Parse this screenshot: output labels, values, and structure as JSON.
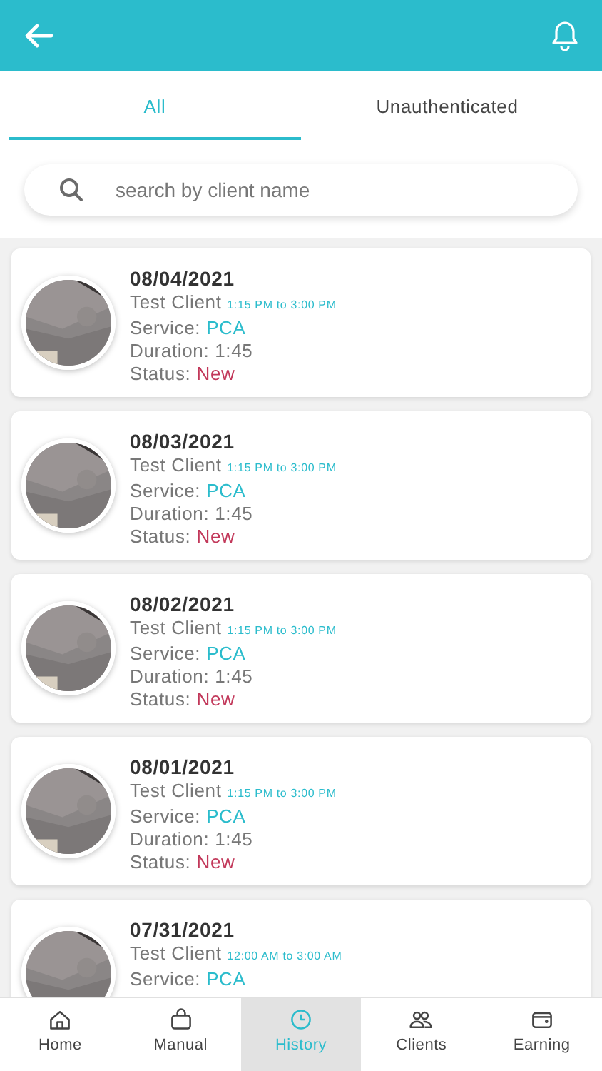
{
  "tabs": [
    {
      "label": "All",
      "selected": true
    },
    {
      "label": "Unauthenticated",
      "selected": false
    }
  ],
  "search": {
    "placeholder": "search by client name"
  },
  "visits": [
    {
      "date": "08/04/2021",
      "client": "Test Client",
      "time": "1:15 PM to 3:00 PM",
      "service_label": "Service:",
      "service": "PCA",
      "duration": "Duration: 1:45",
      "status_label": "Status:",
      "status": "New"
    },
    {
      "date": "08/03/2021",
      "client": "Test Client",
      "time": "1:15 PM to 3:00 PM",
      "service_label": "Service:",
      "service": "PCA",
      "duration": "Duration: 1:45",
      "status_label": "Status:",
      "status": "New"
    },
    {
      "date": "08/02/2021",
      "client": "Test Client",
      "time": "1:15 PM to 3:00 PM",
      "service_label": "Service:",
      "service": "PCA",
      "duration": "Duration: 1:45",
      "status_label": "Status:",
      "status": "New"
    },
    {
      "date": "08/01/2021",
      "client": "Test Client",
      "time": "1:15 PM to 3:00 PM",
      "service_label": "Service:",
      "service": "PCA",
      "duration": "Duration: 1:45",
      "status_label": "Status:",
      "status": "New"
    },
    {
      "date": "07/31/2021",
      "client": "Test Client",
      "time": "12:00 AM to 3:00 AM",
      "service_label": "Service:",
      "service": "PCA"
    }
  ],
  "nav": [
    {
      "label": "Home",
      "kind": "home",
      "selected": false
    },
    {
      "label": "Manual",
      "kind": "bag",
      "selected": false
    },
    {
      "label": "History",
      "kind": "clock",
      "selected": true
    },
    {
      "label": "Clients",
      "kind": "people",
      "selected": false
    },
    {
      "label": "Earning",
      "kind": "wallet",
      "selected": false
    }
  ]
}
